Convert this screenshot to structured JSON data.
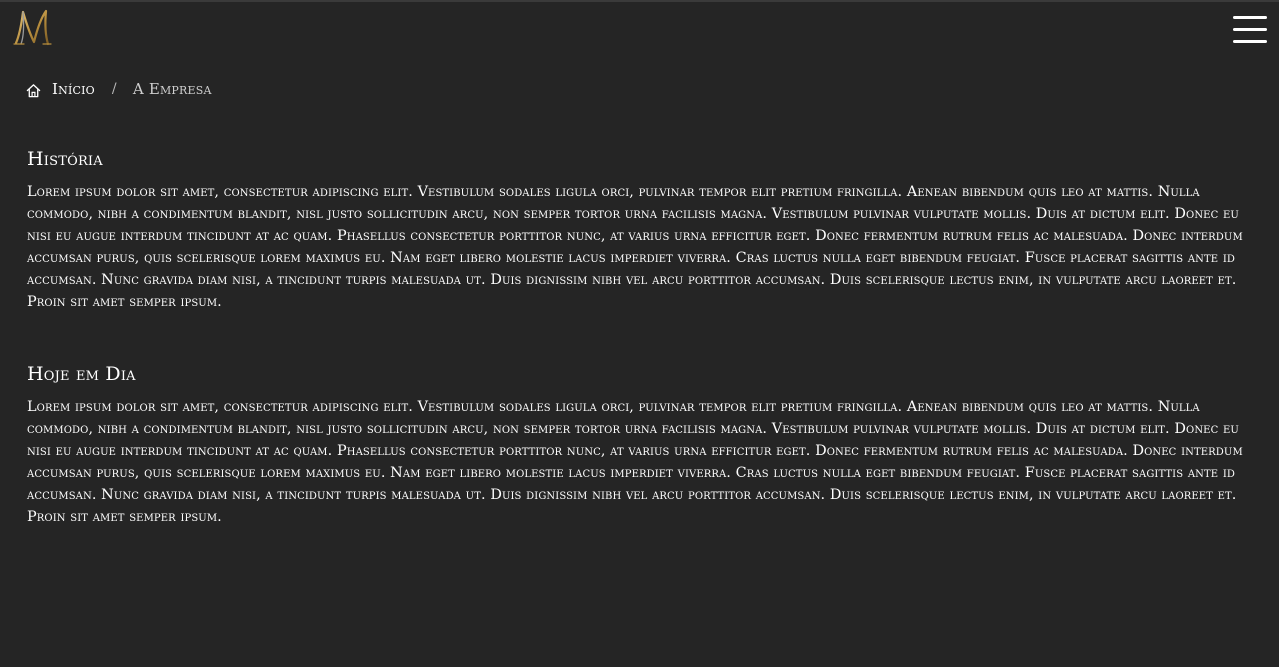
{
  "header": {
    "logo_text": "M",
    "menu_icon": "hamburger-menu-icon"
  },
  "breadcrumb": {
    "home_icon": "home-icon",
    "home_label": "Início",
    "separator": "/",
    "current_label": "A Empresa"
  },
  "sections": [
    {
      "title": "História",
      "body": "Lorem ipsum dolor sit amet, consectetur adipiscing elit. Vestibulum sodales ligula orci, pulvinar tempor elit pretium fringilla. Aenean bibendum quis leo at mattis. Nulla commodo, nibh a condimentum blandit, nisl justo sollicitudin arcu, non semper tortor urna facilisis magna. Vestibulum pulvinar vulputate mollis. Duis at dictum elit. Donec eu nisi eu augue interdum tincidunt at ac quam. Phasellus consectetur porttitor nunc, at varius urna efficitur eget. Donec fermentum rutrum felis ac malesuada. Donec interdum accumsan purus, quis scelerisque lorem maximus eu. Nam eget libero molestie lacus imperdiet viverra. Cras luctus nulla eget bibendum feugiat. Fusce placerat sagittis ante id accumsan. Nunc gravida diam nisi, a tincidunt turpis malesuada ut. Duis dignissim nibh vel arcu porttitor accumsan. Duis scelerisque lectus enim, in vulputate arcu laoreet et. Proin sit amet semper ipsum."
    },
    {
      "title": "Hoje em Dia",
      "body": "Lorem ipsum dolor sit amet, consectetur adipiscing elit. Vestibulum sodales ligula orci, pulvinar tempor elit pretium fringilla. Aenean bibendum quis leo at mattis. Nulla commodo, nibh a condimentum blandit, nisl justo sollicitudin arcu, non semper tortor urna facilisis magna. Vestibulum pulvinar vulputate mollis. Duis at dictum elit. Donec eu nisi eu augue interdum tincidunt at ac quam. Phasellus consectetur porttitor nunc, at varius urna efficitur eget. Donec fermentum rutrum felis ac malesuada. Donec interdum accumsan purus, quis scelerisque lorem maximus eu. Nam eget libero molestie lacus imperdiet viverra. Cras luctus nulla eget bibendum feugiat. Fusce placerat sagittis ante id accumsan. Nunc gravida diam nisi, a tincidunt turpis malesuada ut. Duis dignissim nibh vel arcu porttitor accumsan. Duis scelerisque lectus enim, in vulputate arcu laoreet et. Proin sit amet semper ipsum."
    }
  ],
  "colors": {
    "background": "#252525",
    "text": "#ffffff",
    "logo_gold": "#c9a24a"
  }
}
